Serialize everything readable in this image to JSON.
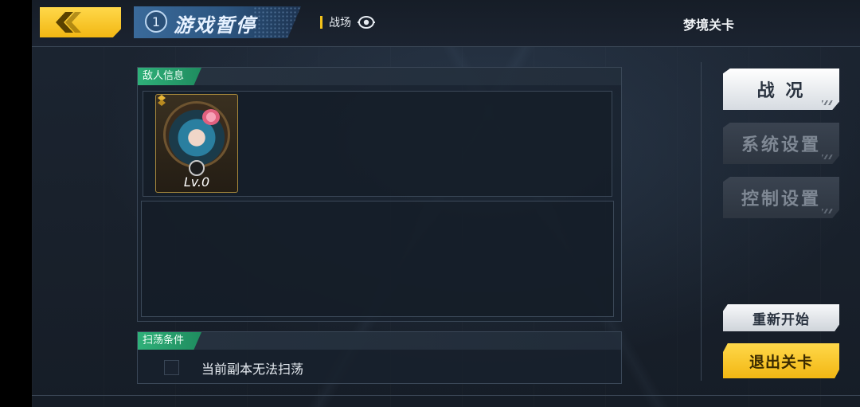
{
  "header": {
    "step_number": "1",
    "title": "游戏暂停",
    "battlefield_label": "战场",
    "stage_name": "梦境关卡"
  },
  "enemy_panel": {
    "heading": "敌人信息",
    "enemies": [
      {
        "level": "Lv.0"
      }
    ]
  },
  "sweep_panel": {
    "heading": "扫荡条件",
    "condition_text": "当前副本无法扫荡",
    "checked": false
  },
  "side_menu": {
    "items": [
      {
        "label": "战 况",
        "active": true
      },
      {
        "label": "系统设置",
        "active": false
      },
      {
        "label": "控制设置",
        "active": false
      }
    ]
  },
  "actions": {
    "restart_label": "重新开始",
    "exit_label": "退出关卡"
  },
  "icons": {
    "back": "chevron-left-icon",
    "battlefield": "eye-target-icon"
  },
  "colors": {
    "accent_yellow": "#f2b713",
    "tab_green": "#2fb079",
    "title_blue": "#2c5580"
  }
}
